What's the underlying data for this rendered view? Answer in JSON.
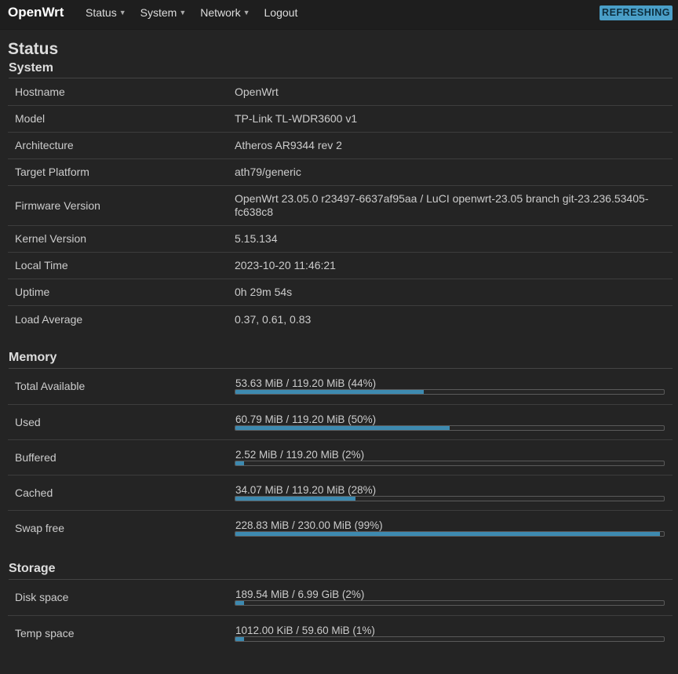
{
  "brand": "OpenWrt",
  "menu": [
    {
      "label": "Status",
      "has_dropdown": true
    },
    {
      "label": "System",
      "has_dropdown": true
    },
    {
      "label": "Network",
      "has_dropdown": true
    },
    {
      "label": "Logout",
      "has_dropdown": false
    }
  ],
  "refresh_badge": "REFRESHING",
  "page_title": "Status",
  "system": {
    "title": "System",
    "rows": [
      {
        "label": "Hostname",
        "value": "OpenWrt"
      },
      {
        "label": "Model",
        "value": "TP-Link TL-WDR3600 v1"
      },
      {
        "label": "Architecture",
        "value": "Atheros AR9344 rev 2"
      },
      {
        "label": "Target Platform",
        "value": "ath79/generic"
      },
      {
        "label": "Firmware Version",
        "value": "OpenWrt 23.05.0 r23497-6637af95aa / LuCI openwrt-23.05 branch git-23.236.53405-fc638c8"
      },
      {
        "label": "Kernel Version",
        "value": "5.15.134"
      },
      {
        "label": "Local Time",
        "value": "2023-10-20 11:46:21"
      },
      {
        "label": "Uptime",
        "value": "0h 29m 54s"
      },
      {
        "label": "Load Average",
        "value": "0.37, 0.61, 0.83"
      }
    ]
  },
  "memory": {
    "title": "Memory",
    "rows": [
      {
        "label": "Total Available",
        "text": "53.63 MiB / 119.20 MiB (44%)",
        "percent": 44
      },
      {
        "label": "Used",
        "text": "60.79 MiB / 119.20 MiB (50%)",
        "percent": 50
      },
      {
        "label": "Buffered",
        "text": "2.52 MiB / 119.20 MiB (2%)",
        "percent": 2
      },
      {
        "label": "Cached",
        "text": "34.07 MiB / 119.20 MiB (28%)",
        "percent": 28
      },
      {
        "label": "Swap free",
        "text": "228.83 MiB / 230.00 MiB (99%)",
        "percent": 99
      }
    ]
  },
  "storage": {
    "title": "Storage",
    "rows": [
      {
        "label": "Disk space",
        "text": "189.54 MiB / 6.99 GiB (2%)",
        "percent": 2
      },
      {
        "label": "Temp space",
        "text": "1012.00 KiB / 59.60 MiB (1%)",
        "percent": 1
      }
    ]
  },
  "colors": {
    "accent": "#4a9fc8",
    "bar_fill": "#3d8ab0",
    "background": "#242424"
  }
}
